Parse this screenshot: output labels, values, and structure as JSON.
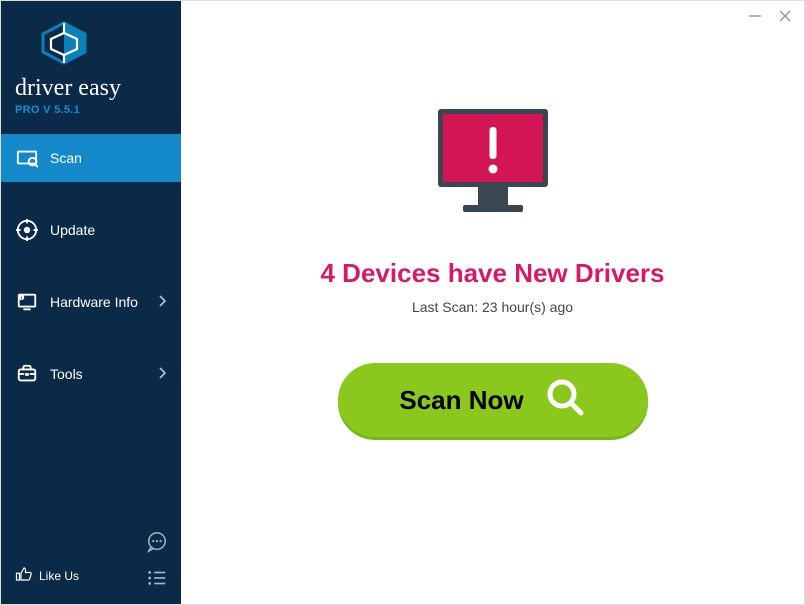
{
  "brand": {
    "title": "driver easy",
    "sub_prefix": "PRO V ",
    "version": "5.5.1"
  },
  "nav": {
    "scan": "Scan",
    "update": "Update",
    "hardware_info": "Hardware Info",
    "tools": "Tools"
  },
  "footer": {
    "like_us": "Like Us"
  },
  "status": {
    "title": "4 Devices have New Drivers",
    "sub": "Last Scan: 23 hour(s) ago"
  },
  "scan_button": "Scan Now",
  "colors": {
    "accent_pink": "#d61a67",
    "monitor_crimson": "#d31556",
    "scan_green": "#8bc81e",
    "sidebar_bg": "#0b2a47",
    "active_blue": "#1489c9"
  }
}
